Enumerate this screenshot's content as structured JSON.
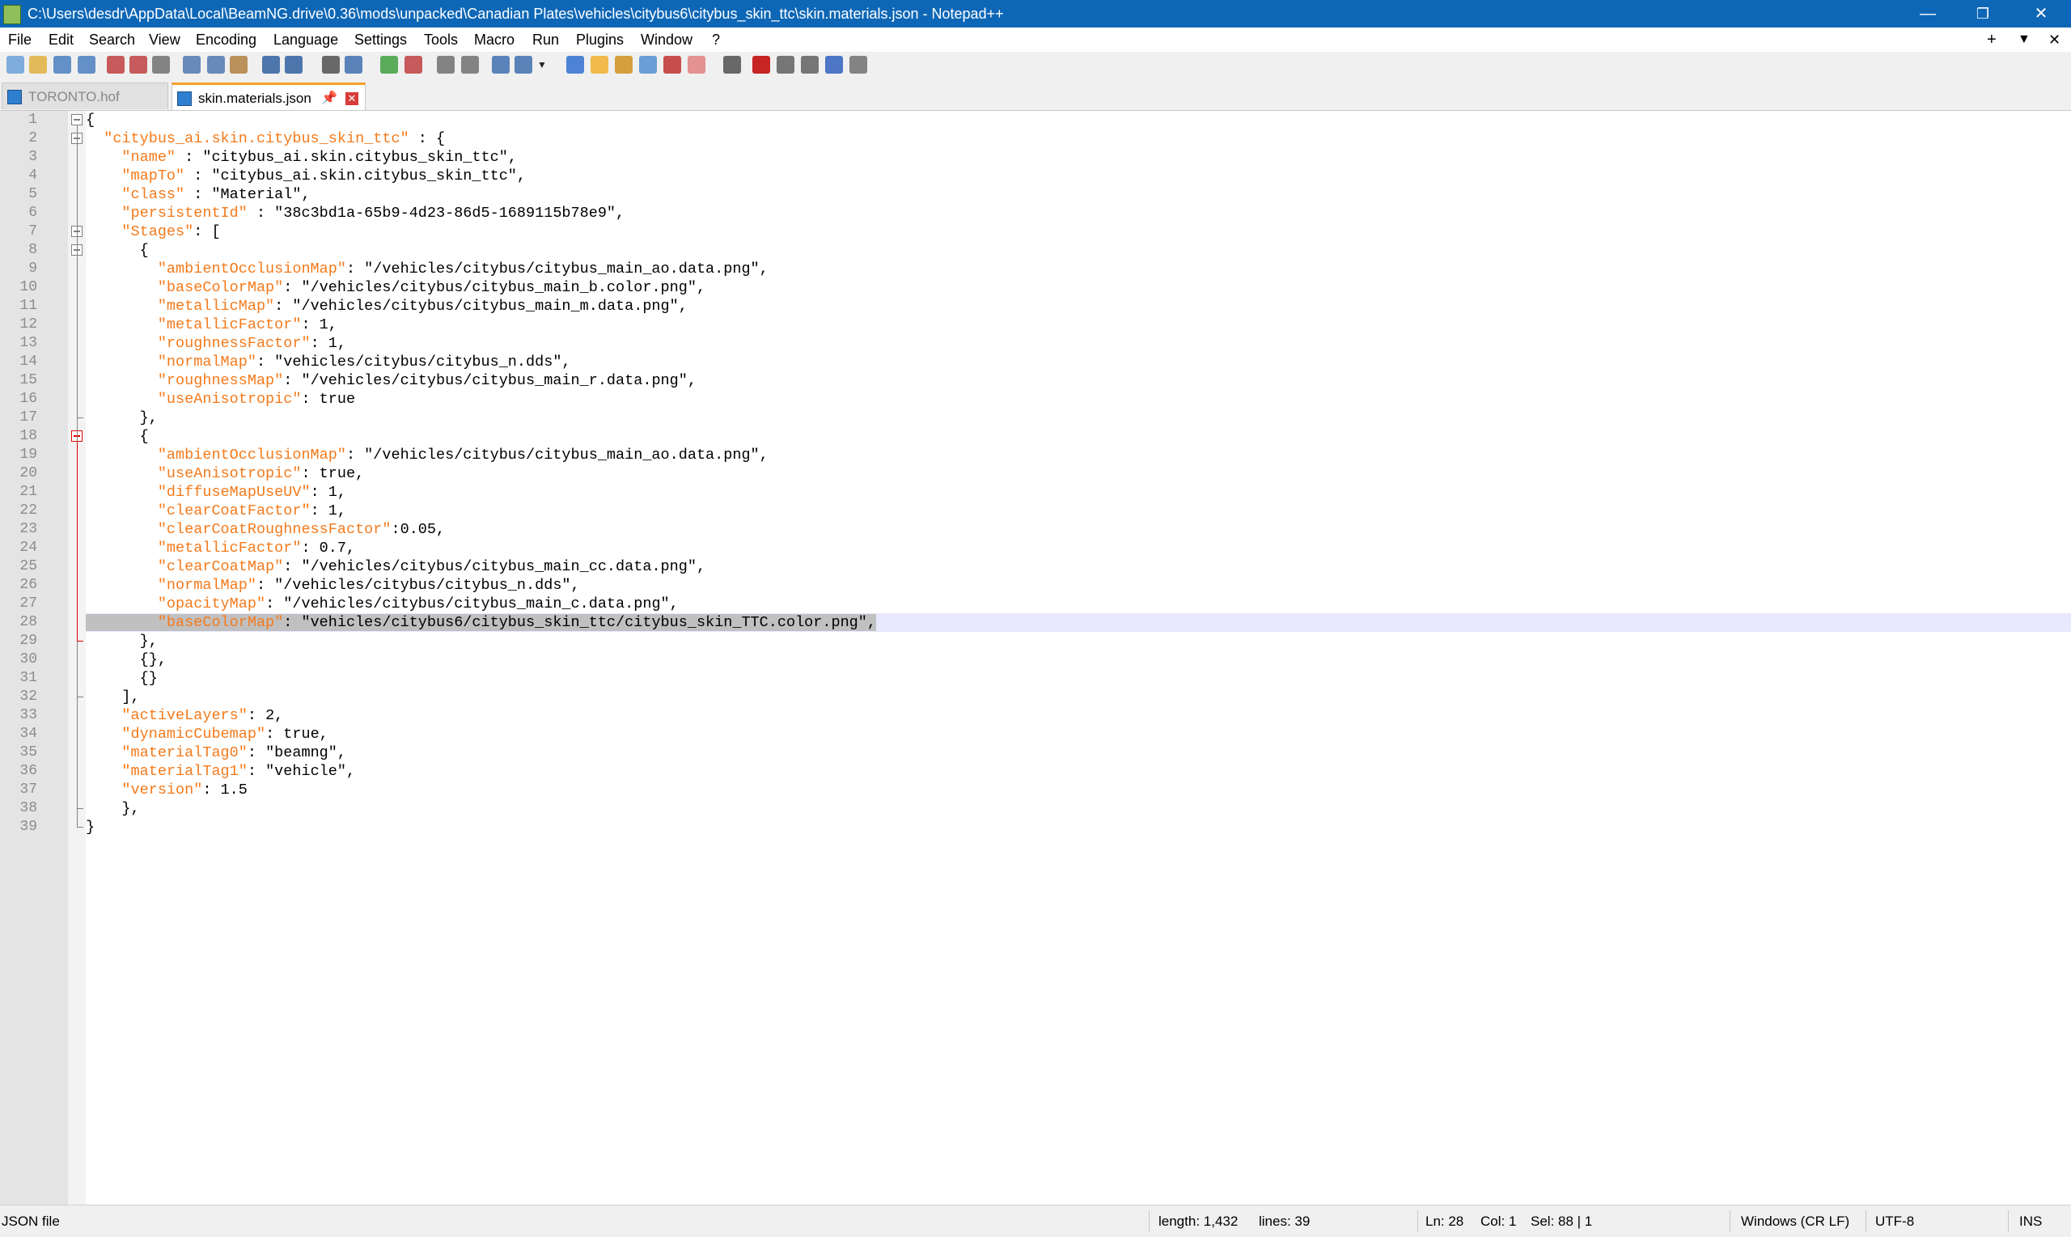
{
  "window": {
    "title": "C:\\Users\\desdr\\AppData\\Local\\BeamNG.drive\\0.36\\mods\\unpacked\\Canadian Plates\\vehicles\\citybus6\\citybus_skin_ttc\\skin.materials.json - Notepad++",
    "minimize": "—",
    "restore": "❐",
    "close": "✕"
  },
  "menu": {
    "items": [
      "File",
      "Edit",
      "Search",
      "View",
      "Encoding",
      "Language",
      "Settings",
      "Tools",
      "Macro",
      "Run",
      "Plugins",
      "Window",
      "?"
    ],
    "plus": "+",
    "dropdown": "▼",
    "close": "✕"
  },
  "tabs": [
    {
      "label": "TORONTO.hof",
      "active": false
    },
    {
      "label": "skin.materials.json",
      "active": true,
      "pin": "📌",
      "close": "✕"
    }
  ],
  "editor": {
    "current_line": 28,
    "lines": [
      [
        {
          "t": "{"
        }
      ],
      [
        {
          "t": "  "
        },
        {
          "k": "\"citybus_ai.skin.citybus_skin_ttc\""
        },
        {
          "t": " : {"
        }
      ],
      [
        {
          "t": "    "
        },
        {
          "k": "\"name\""
        },
        {
          "t": " : \"citybus_ai.skin.citybus_skin_ttc\","
        }
      ],
      [
        {
          "t": "    "
        },
        {
          "k": "\"mapTo\""
        },
        {
          "t": " : \"citybus_ai.skin.citybus_skin_ttc\","
        }
      ],
      [
        {
          "t": "    "
        },
        {
          "k": "\"class\""
        },
        {
          "t": " : \"Material\","
        }
      ],
      [
        {
          "t": "    "
        },
        {
          "k": "\"persistentId\""
        },
        {
          "t": " : \"38c3bd1a-65b9-4d23-86d5-1689115b78e9\","
        }
      ],
      [
        {
          "t": "    "
        },
        {
          "k": "\"Stages\""
        },
        {
          "t": ": ["
        }
      ],
      [
        {
          "t": "      {"
        }
      ],
      [
        {
          "t": "        "
        },
        {
          "k": "\"ambientOcclusionMap\""
        },
        {
          "t": ": \"/vehicles/citybus/citybus_main_ao.data.png\","
        }
      ],
      [
        {
          "t": "        "
        },
        {
          "k": "\"baseColorMap\""
        },
        {
          "t": ": \"/vehicles/citybus/citybus_main_b.color.png\","
        }
      ],
      [
        {
          "t": "        "
        },
        {
          "k": "\"metallicMap\""
        },
        {
          "t": ": \"/vehicles/citybus/citybus_main_m.data.png\","
        }
      ],
      [
        {
          "t": "        "
        },
        {
          "k": "\"metallicFactor\""
        },
        {
          "t": ": 1,"
        }
      ],
      [
        {
          "t": "        "
        },
        {
          "k": "\"roughnessFactor\""
        },
        {
          "t": ": 1,"
        }
      ],
      [
        {
          "t": "        "
        },
        {
          "k": "\"normalMap\""
        },
        {
          "t": ": \"vehicles/citybus/citybus_n.dds\","
        }
      ],
      [
        {
          "t": "        "
        },
        {
          "k": "\"roughnessMap\""
        },
        {
          "t": ": \"/vehicles/citybus/citybus_main_r.data.png\","
        }
      ],
      [
        {
          "t": "        "
        },
        {
          "k": "\"useAnisotropic\""
        },
        {
          "t": ": true"
        }
      ],
      [
        {
          "t": "      },"
        }
      ],
      [
        {
          "t": "      {"
        }
      ],
      [
        {
          "t": "        "
        },
        {
          "k": "\"ambientOcclusionMap\""
        },
        {
          "t": ": \"/vehicles/citybus/citybus_main_ao.data.png\","
        }
      ],
      [
        {
          "t": "        "
        },
        {
          "k": "\"useAnisotropic\""
        },
        {
          "t": ": true,"
        }
      ],
      [
        {
          "t": "        "
        },
        {
          "k": "\"diffuseMapUseUV\""
        },
        {
          "t": ": 1,"
        }
      ],
      [
        {
          "t": "        "
        },
        {
          "k": "\"clearCoatFactor\""
        },
        {
          "t": ": 1,"
        }
      ],
      [
        {
          "t": "        "
        },
        {
          "k": "\"clearCoatRoughnessFactor\""
        },
        {
          "t": ":0.05,"
        }
      ],
      [
        {
          "t": "        "
        },
        {
          "k": "\"metallicFactor\""
        },
        {
          "t": ": 0.7,"
        }
      ],
      [
        {
          "t": "        "
        },
        {
          "k": "\"clearCoatMap\""
        },
        {
          "t": ": \"/vehicles/citybus/citybus_main_cc.data.png\","
        }
      ],
      [
        {
          "t": "        "
        },
        {
          "k": "\"normalMap\""
        },
        {
          "t": ": \"/vehicles/citybus/citybus_n.dds\","
        }
      ],
      [
        {
          "t": "        "
        },
        {
          "k": "\"opacityMap\""
        },
        {
          "t": ": \"/vehicles/citybus/citybus_main_c.data.png\","
        }
      ],
      [
        {
          "t": "        ",
          "s": 1
        },
        {
          "k": "\"baseColorMap\"",
          "s": 1
        },
        {
          "t": ": \"vehicles/citybus6/citybus_skin_ttc/citybus_skin_TTC.color.png\",",
          "s": 1
        }
      ],
      [
        {
          "t": "      },"
        }
      ],
      [
        {
          "t": "      {},"
        }
      ],
      [
        {
          "t": "      {}"
        }
      ],
      [
        {
          "t": "    ],"
        }
      ],
      [
        {
          "t": "    "
        },
        {
          "k": "\"activeLayers\""
        },
        {
          "t": ": 2,"
        }
      ],
      [
        {
          "t": "    "
        },
        {
          "k": "\"dynamicCubemap\""
        },
        {
          "t": ": true,"
        }
      ],
      [
        {
          "t": "    "
        },
        {
          "k": "\"materialTag0\""
        },
        {
          "t": ": \"beamng\","
        }
      ],
      [
        {
          "t": "    "
        },
        {
          "k": "\"materialTag1\""
        },
        {
          "t": ": \"vehicle\","
        }
      ],
      [
        {
          "t": "    "
        },
        {
          "k": "\"version\""
        },
        {
          "t": ": 1.5"
        }
      ],
      [
        {
          "t": "    },"
        }
      ],
      [
        {
          "t": "}"
        }
      ]
    ]
  },
  "status": {
    "file_type": "JSON file",
    "length": "length: 1,432",
    "lines": "lines: 39",
    "ln": "Ln: 28",
    "col": "Col: 1",
    "sel": "Sel: 88 | 1",
    "eol": "Windows (CR LF)",
    "encoding": "UTF-8",
    "mode": "INS"
  },
  "colors": {
    "titlebar": "#0e67b6",
    "json_key": "#f47a1b",
    "tab_accent": "#f59f2c",
    "current_line": "#e8e8ff",
    "selection": "#c0c0c0"
  },
  "toolbar_icons": [
    "new-file-icon",
    "open-file-icon",
    "save-icon",
    "save-all-icon",
    "close-icon",
    "close-all-icon",
    "print-icon",
    "cut-icon",
    "copy-icon",
    "paste-icon",
    "undo-icon",
    "redo-icon",
    "find-icon",
    "replace-icon",
    "zoom-in-icon",
    "zoom-out-icon",
    "sync-v-icon",
    "sync-h-icon",
    "word-wrap-icon",
    "show-all-chars-icon",
    "dropdown-icon",
    "indent-guide-icon",
    "doc-map-icon",
    "function-list-icon",
    "folder-workspace-icon",
    "monitoring-icon",
    "user-lang-icon",
    "eye-icon",
    "record-macro-icon",
    "stop-macro-icon",
    "play-macro-icon",
    "run-macro-multiple-icon",
    "save-macro-icon"
  ]
}
